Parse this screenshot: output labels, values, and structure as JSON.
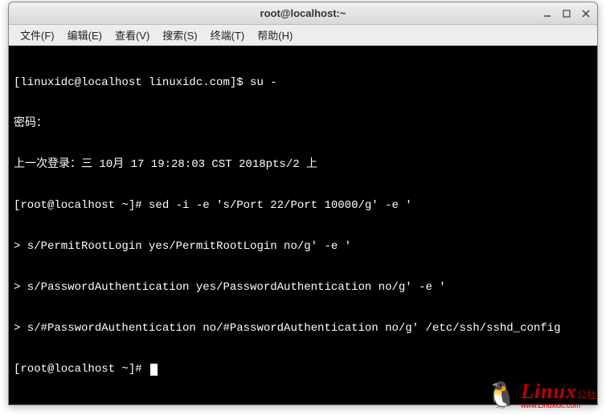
{
  "titlebar": {
    "title": "root@localhost:~"
  },
  "menubar": {
    "items": [
      "文件(F)",
      "编辑(E)",
      "查看(V)",
      "搜索(S)",
      "终端(T)",
      "帮助(H)"
    ]
  },
  "terminal": {
    "lines": [
      "[linuxidc@localhost linuxidc.com]$ su -",
      "密码：",
      "上一次登录：三 10月 17 19:28:03 CST 2018pts/2 上",
      "[root@localhost ~]# sed -i -e 's/Port 22/Port 10000/g' -e '",
      "> s/PermitRootLogin yes/PermitRootLogin no/g' -e '",
      "> s/PasswordAuthentication yes/PasswordAuthentication no/g' -e '",
      "> s/#PasswordAuthentication no/#PasswordAuthentication no/g' /etc/ssh/sshd_config",
      "[root@localhost ~]# "
    ]
  },
  "watermark": {
    "logo": "Linux",
    "suffix": "公社",
    "url": "www.Linuxidc.com"
  }
}
